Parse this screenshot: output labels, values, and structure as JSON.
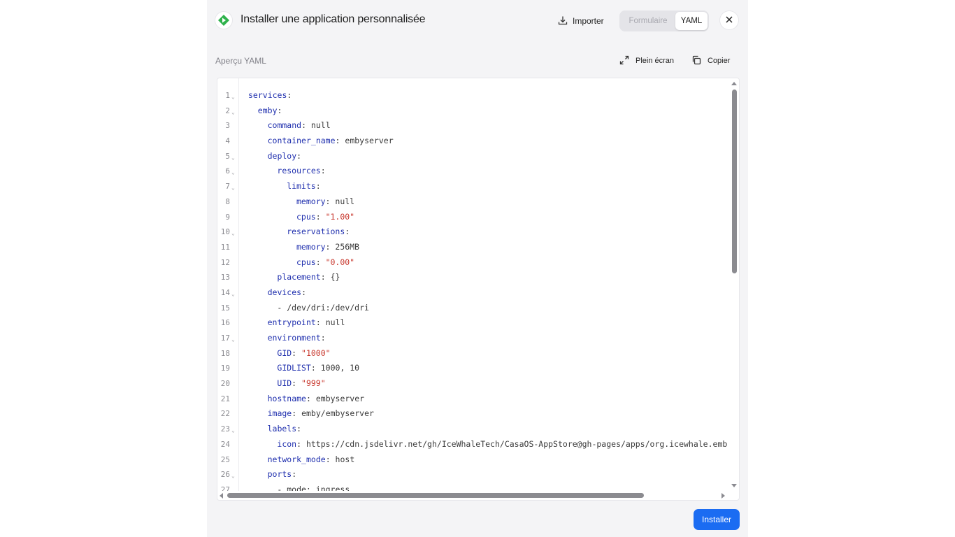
{
  "header": {
    "title": "Installer une application personnalisée",
    "import_label": "Importer",
    "mode_toggle": {
      "options": [
        "Formulaire",
        "YAML"
      ],
      "selected": "YAML"
    },
    "logo_icon": "app-logo-icon",
    "close_icon": "close-icon"
  },
  "toolbar": {
    "section_label": "Aperçu YAML",
    "fullscreen_label": "Plein écran",
    "copy_label": "Copier"
  },
  "editor": {
    "lines": [
      {
        "n": "1",
        "fold": true,
        "indent": 0,
        "key": "services",
        "sep": ":",
        "val": "",
        "str": ""
      },
      {
        "n": "2",
        "fold": true,
        "indent": 1,
        "key": "emby",
        "sep": ":",
        "val": "",
        "str": ""
      },
      {
        "n": "3",
        "fold": false,
        "indent": 2,
        "key": "command",
        "sep": ": ",
        "val": "null",
        "str": ""
      },
      {
        "n": "4",
        "fold": false,
        "indent": 2,
        "key": "container_name",
        "sep": ": ",
        "val": "embyserver",
        "str": ""
      },
      {
        "n": "5",
        "fold": true,
        "indent": 2,
        "key": "deploy",
        "sep": ":",
        "val": "",
        "str": ""
      },
      {
        "n": "6",
        "fold": true,
        "indent": 3,
        "key": "resources",
        "sep": ":",
        "val": "",
        "str": ""
      },
      {
        "n": "7",
        "fold": true,
        "indent": 4,
        "key": "limits",
        "sep": ":",
        "val": "",
        "str": ""
      },
      {
        "n": "8",
        "fold": false,
        "indent": 5,
        "key": "memory",
        "sep": ": ",
        "val": "null",
        "str": ""
      },
      {
        "n": "9",
        "fold": false,
        "indent": 5,
        "key": "cpus",
        "sep": ": ",
        "val": "",
        "str": "\"1.00\""
      },
      {
        "n": "10",
        "fold": true,
        "indent": 4,
        "key": "reservations",
        "sep": ":",
        "val": "",
        "str": ""
      },
      {
        "n": "11",
        "fold": false,
        "indent": 5,
        "key": "memory",
        "sep": ": ",
        "val": "256MB",
        "str": ""
      },
      {
        "n": "12",
        "fold": false,
        "indent": 5,
        "key": "cpus",
        "sep": ": ",
        "val": "",
        "str": "\"0.00\""
      },
      {
        "n": "13",
        "fold": false,
        "indent": 3,
        "key": "placement",
        "sep": ": ",
        "val": "{}",
        "str": ""
      },
      {
        "n": "14",
        "fold": true,
        "indent": 2,
        "key": "devices",
        "sep": ":",
        "val": "",
        "str": ""
      },
      {
        "n": "15",
        "fold": false,
        "indent": 3,
        "key": "",
        "sep": "",
        "val": "- /dev/dri:/dev/dri",
        "str": ""
      },
      {
        "n": "16",
        "fold": false,
        "indent": 2,
        "key": "entrypoint",
        "sep": ": ",
        "val": "null",
        "str": ""
      },
      {
        "n": "17",
        "fold": true,
        "indent": 2,
        "key": "environment",
        "sep": ":",
        "val": "",
        "str": ""
      },
      {
        "n": "18",
        "fold": false,
        "indent": 3,
        "key": "GID",
        "sep": ": ",
        "val": "",
        "str": "\"1000\""
      },
      {
        "n": "19",
        "fold": false,
        "indent": 3,
        "key": "GIDLIST",
        "sep": ": ",
        "val": "1000, 10",
        "str": ""
      },
      {
        "n": "20",
        "fold": false,
        "indent": 3,
        "key": "UID",
        "sep": ": ",
        "val": "",
        "str": "\"999\""
      },
      {
        "n": "21",
        "fold": false,
        "indent": 2,
        "key": "hostname",
        "sep": ": ",
        "val": "embyserver",
        "str": ""
      },
      {
        "n": "22",
        "fold": false,
        "indent": 2,
        "key": "image",
        "sep": ": ",
        "val": "emby/embyserver",
        "str": ""
      },
      {
        "n": "23",
        "fold": true,
        "indent": 2,
        "key": "labels",
        "sep": ":",
        "val": "",
        "str": ""
      },
      {
        "n": "24",
        "fold": false,
        "indent": 3,
        "key": "icon",
        "sep": ": ",
        "val": "https://cdn.jsdelivr.net/gh/IceWhaleTech/CasaOS-AppStore@gh-pages/apps/org.icewhale.emb",
        "str": ""
      },
      {
        "n": "25",
        "fold": false,
        "indent": 2,
        "key": "network_mode",
        "sep": ": ",
        "val": "host",
        "str": ""
      },
      {
        "n": "26",
        "fold": true,
        "indent": 2,
        "key": "ports",
        "sep": ":",
        "val": "",
        "str": ""
      },
      {
        "n": "27",
        "fold": false,
        "indent": 3,
        "key": "",
        "sep": "",
        "val": "- mode: ingress",
        "str": ""
      }
    ]
  },
  "footer": {
    "install_label": "Installer"
  },
  "colors": {
    "accent": "#1b6cf2",
    "yaml_key": "#1f2fae",
    "yaml_string": "#c8372d",
    "logo_green": "#2fb24c"
  }
}
